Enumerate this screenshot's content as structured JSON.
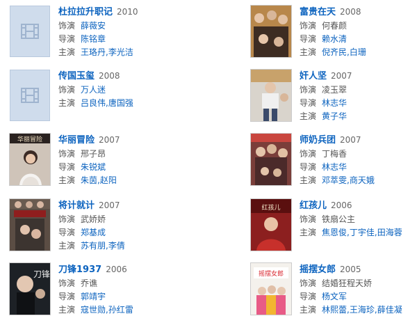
{
  "labels": {
    "role": "饰演",
    "director": "导演",
    "cast": "主演"
  },
  "left": [
    {
      "title": "杜拉拉升职记",
      "year": "2010",
      "role": "薛薇安",
      "role_link": true,
      "director": [
        "陈铭章"
      ],
      "cast": [
        "王珞丹",
        "李光洁"
      ],
      "poster": "placeholder"
    },
    {
      "title": "传国玉玺",
      "year": "2008",
      "role": "万人迷",
      "role_link": false,
      "director": [
        "吕良伟",
        "唐国强"
      ],
      "cast_in_director_row": true,
      "poster": "placeholder"
    },
    {
      "title": "华丽冒险",
      "year": "2007",
      "role": "邢子昂",
      "role_link": false,
      "director": [
        "朱锐斌"
      ],
      "cast": [
        "朱茵",
        "赵阳"
      ],
      "poster": "hualimaoxian"
    },
    {
      "title": "将计就计",
      "year": "2007",
      "role": "武娇娇",
      "role_link": false,
      "director": [
        "郑基成"
      ],
      "cast": [
        "苏有朋",
        "李倩"
      ],
      "poster": "jiangjijiuji"
    },
    {
      "title": "刀锋1937",
      "year": "2006",
      "role": "乔谯",
      "role_link": false,
      "director": [
        "郭靖宇"
      ],
      "cast": [
        "寇世勋",
        "孙红雷"
      ],
      "poster": "daofeng"
    }
  ],
  "right": [
    {
      "title": "富贵在天",
      "year": "2008",
      "role": "何春颜",
      "role_link": false,
      "director": [
        "赖水清"
      ],
      "cast": [
        "倪齐民",
        "白珊"
      ],
      "poster": "fugui"
    },
    {
      "title": "奸人坚",
      "year": "2007",
      "role": "凌玉翠",
      "role_link": false,
      "director": [
        "林志华"
      ],
      "cast": [
        "黄子华"
      ],
      "poster": "jianrenjian"
    },
    {
      "title": "师奶兵团",
      "year": "2007",
      "role": "丁梅香",
      "role_link": false,
      "director": [
        "林志华"
      ],
      "cast": [
        "邓萃雯",
        "商天娥"
      ],
      "poster": "shinai"
    },
    {
      "title": "红孩儿",
      "year": "2006",
      "role": "铁扇公主",
      "role_link": false,
      "director": [
        "焦恩俊",
        "丁宇佳",
        "田海蓉"
      ],
      "cast_in_director_row": true,
      "poster": "honghaier"
    },
    {
      "title": "摇摆女郎",
      "year": "2005",
      "role": "结婚狂程天娇",
      "role_link": false,
      "director": [
        "杨文军"
      ],
      "cast": [
        "林熙蕾",
        "王海珍",
        "薛佳凝"
      ],
      "poster": "yaobai"
    }
  ],
  "poster_text": {
    "hualimaoxian": "华丽冒险",
    "daofeng": "刀锋",
    "yaobai": "摇摆女郎",
    "honghaier": "红孩儿"
  }
}
